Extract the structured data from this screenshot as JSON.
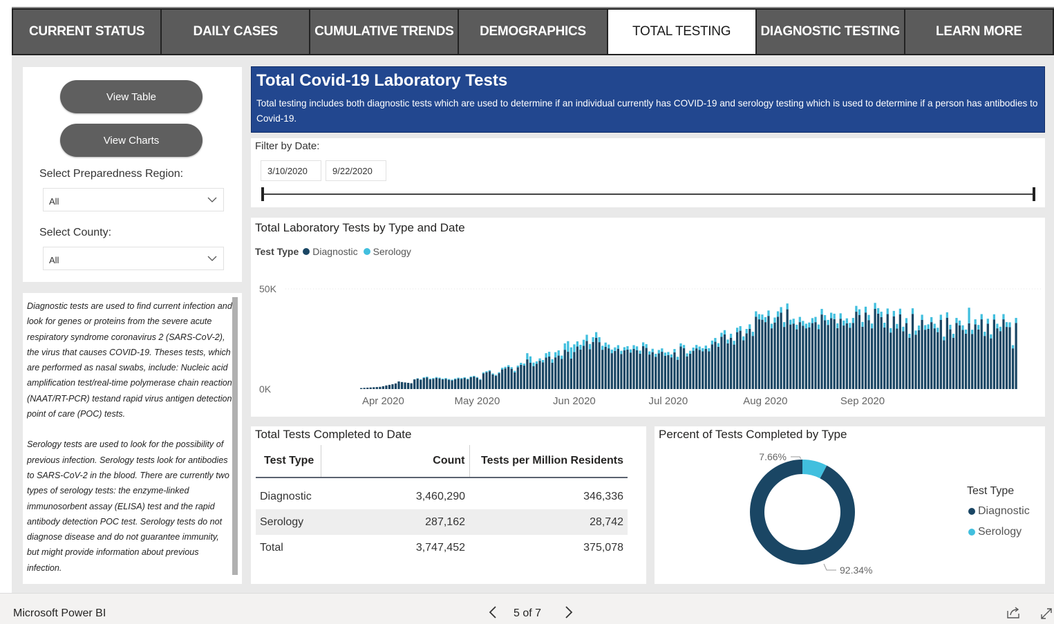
{
  "tabs": [
    {
      "label": "CURRENT STATUS",
      "active": false
    },
    {
      "label": "DAILY CASES",
      "active": false
    },
    {
      "label": "CUMULATIVE TRENDS",
      "active": false
    },
    {
      "label": "DEMOGRAPHICS",
      "active": false
    },
    {
      "label": "TOTAL TESTING",
      "active": true
    },
    {
      "label": "DIAGNOSTIC TESTING",
      "active": false
    },
    {
      "label": "LEARN MORE",
      "active": false
    }
  ],
  "sidebar": {
    "view_table": "View Table",
    "view_charts": "View Charts",
    "region_label": "Select Preparedness Region:",
    "region_value": "All",
    "county_label": "Select County:",
    "county_value": "All"
  },
  "description": {
    "p1": "Diagnostic tests are used to find current infection and look for genes or proteins from the severe acute respiratory syndrome coronavirus 2 (SARS-CoV-2), the virus that causes COVID-19. Theses tests, which are performed as nasal swabs, include: Nucleic acid amplification test/real-time polymerase chain reaction (NAAT/RT-PCR) testand rapid virus antigen detection point of care (POC) tests.",
    "p2": "Serology tests are used to look for the possibility of previous infection. Serology tests look for antibodies to SARS-CoV-2 in the blood. There are currently two types of serology tests: the enzyme-linked immunosorbent assay (ELISA) test and the rapid antibody detection POC test. Serology tests do not diagnose disease and do not guarantee immunity, but might provide information about previous infection."
  },
  "banner": {
    "title": "Total Covid-19 Laboratory Tests",
    "subtitle": "Total testing includes both diagnostic tests which are used to determine if an individual currently has COVID-19 and serology testing which is used to determine if a person has antibodies to Covid-19."
  },
  "filter": {
    "label": "Filter by Date:",
    "start": "3/10/2020",
    "end": "9/22/2020"
  },
  "colors": {
    "diagnostic": "#1a4664",
    "serology": "#41bfde",
    "banner": "#22478f"
  },
  "table": {
    "title": "Total Tests Completed to Date",
    "headers": [
      "Test Type",
      "Count",
      "Tests per Million Residents"
    ],
    "rows": [
      [
        "Diagnostic",
        "3,460,290",
        "346,336"
      ],
      [
        "Serology",
        "287,162",
        "28,742"
      ],
      [
        "Total",
        "3,747,452",
        "375,078"
      ]
    ]
  },
  "footer": {
    "brand": "Microsoft Power BI",
    "page": "5 of 7"
  },
  "chart_data": [
    {
      "type": "bar",
      "stacked": true,
      "title": "Total Laboratory Tests by Type and Date",
      "legend_title": "Test Type",
      "legend_position": "top-left",
      "xlabel": "",
      "ylabel": "",
      "x_ticks": [
        "Apr 2020",
        "May 2020",
        "Jun 2020",
        "Jul 2020",
        "Aug 2020",
        "Sep 2020"
      ],
      "y_ticks": [
        "0K",
        "50K"
      ],
      "ylim": [
        0,
        50000
      ],
      "grid": true,
      "x_start": "2020-03-10",
      "x_end": "2020-09-22",
      "series": [
        {
          "name": "Diagnostic",
          "values": [
            0,
            0,
            0,
            0,
            0,
            0,
            0,
            0,
            0,
            0,
            0,
            0,
            0,
            0,
            0,
            500,
            600,
            700,
            800,
            900,
            1000,
            1100,
            1400,
            1800,
            2100,
            2400,
            2800,
            3800,
            3500,
            3300,
            3100,
            2900,
            4800,
            5200,
            4600,
            5500,
            5800,
            4800,
            5100,
            5600,
            5300,
            4800,
            5100,
            4600,
            4300,
            4900,
            5300,
            5100,
            5500,
            4800,
            5900,
            6200,
            5600,
            4600,
            7800,
            8400,
            8900,
            7300,
            6600,
            7900,
            9800,
            10300,
            11100,
            10100,
            8300,
            10900,
            12100,
            11700,
            14800,
            13100,
            11400,
            12600,
            14100,
            13300,
            15700,
            16200,
            13100,
            15800,
            16700,
            15000,
            19600,
            18600,
            15200,
            18500,
            21200,
            19700,
            21600,
            24000,
            19900,
            23500,
            25600,
            23400,
            19600,
            21100,
            20300,
            17900,
            19000,
            20100,
            17500,
            19300,
            19700,
            18200,
            20000,
            19400,
            17600,
            21400,
            20500,
            17200,
            18400,
            16100,
            17800,
            18600,
            16600,
            16900,
            15800,
            18300,
            14600,
            21200,
            20400,
            16300,
            17600,
            19100,
            20300,
            19500,
            18800,
            20000,
            18800,
            22300,
            23600,
            21100,
            26100,
            27300,
            22800,
            25600,
            22200,
            28400,
            29100,
            24300,
            27800,
            30000,
            26500,
            36100,
            34800,
            34600,
            33400,
            36500,
            30300,
            33200,
            36100,
            38100,
            31000,
            39800,
            32200,
            32600,
            29800,
            33400,
            31600,
            30300,
            30800,
            32900,
            33400,
            29900,
            37200,
            34300,
            32000,
            35400,
            34900,
            30400,
            35100,
            31700,
            32800,
            30600,
            33000,
            38600,
            37000,
            31100,
            38200,
            34400,
            30300,
            40000,
            37600,
            35900,
            30700,
            37400,
            28200,
            36300,
            30200,
            37300,
            28800,
            32900,
            25600,
            37500,
            27100,
            29400,
            34500,
            29600,
            30000,
            33400,
            30300,
            28400,
            34500,
            24300,
            35600,
            29800,
            25600,
            33000,
            31800,
            29500,
            27600,
            32800,
            27500,
            32300,
            29700,
            34800,
            26500,
            32600,
            25300,
            34700,
            30300,
            28900,
            34800,
            31000,
            30900,
            20300,
            33000
          ]
        },
        {
          "name": "Serology",
          "values": [
            0,
            0,
            0,
            0,
            0,
            0,
            0,
            0,
            0,
            0,
            0,
            0,
            0,
            0,
            0,
            0,
            0,
            0,
            0,
            0,
            0,
            0,
            0,
            0,
            0,
            0,
            0,
            0,
            0,
            0,
            0,
            0,
            100,
            200,
            300,
            400,
            400,
            400,
            400,
            400,
            400,
            400,
            400,
            400,
            400,
            400,
            400,
            400,
            400,
            400,
            400,
            400,
            400,
            400,
            500,
            500,
            500,
            500,
            500,
            500,
            800,
            800,
            800,
            800,
            800,
            800,
            1000,
            1000,
            3100,
            3200,
            1800,
            1200,
            1200,
            1200,
            2200,
            2400,
            1800,
            2600,
            2600,
            1700,
            3200,
            5300,
            5600,
            3800,
            2600,
            2400,
            3000,
            3100,
            2600,
            2400,
            2800,
            2500,
            2000,
            2100,
            1900,
            1800,
            1800,
            1800,
            1600,
            1600,
            1700,
            1600,
            1900,
            1900,
            1600,
            1900,
            1900,
            1600,
            1700,
            1500,
            1700,
            1700,
            1600,
            1600,
            1500,
            1700,
            1500,
            1600,
            1600,
            1500,
            1500,
            1600,
            1700,
            1700,
            1600,
            1700,
            1600,
            1900,
            1900,
            1800,
            2000,
            2100,
            1900,
            2000,
            1900,
            2200,
            2300,
            2000,
            2200,
            2300,
            2100,
            2700,
            2600,
            2600,
            2500,
            2700,
            2300,
            2500,
            2700,
            2800,
            2400,
            2900,
            2400,
            2500,
            2300,
            2600,
            2400,
            2300,
            2400,
            2500,
            2600,
            2300,
            2800,
            2600,
            2500,
            2700,
            2700,
            2400,
            2700,
            2500,
            2500,
            2400,
            2500,
            2900,
            2800,
            2400,
            2900,
            2600,
            2400,
            3000,
            2800,
            2700,
            2400,
            2800,
            2200,
            2700,
            2300,
            2800,
            2300,
            2500,
            2000,
            2800,
            2100,
            2300,
            2600,
            2300,
            2300,
            2500,
            2300,
            2200,
            2600,
            1900,
            2700,
            2300,
            2000,
            2500,
            2400,
            2300,
            2100,
            7800,
            2100,
            2500,
            2300,
            2600,
            2100,
            2500,
            2000,
            2600,
            2300,
            2200,
            2600,
            2400,
            2400,
            1600,
            2500
          ]
        }
      ]
    },
    {
      "type": "pie",
      "donut": true,
      "title": "Percent of Tests Completed by Type",
      "legend_title": "Test Type",
      "legend_position": "right",
      "labels": [
        "Diagnostic",
        "Serology"
      ],
      "values": [
        92.34,
        7.66
      ],
      "data_labels": [
        "92.34%",
        "7.66%"
      ]
    }
  ]
}
